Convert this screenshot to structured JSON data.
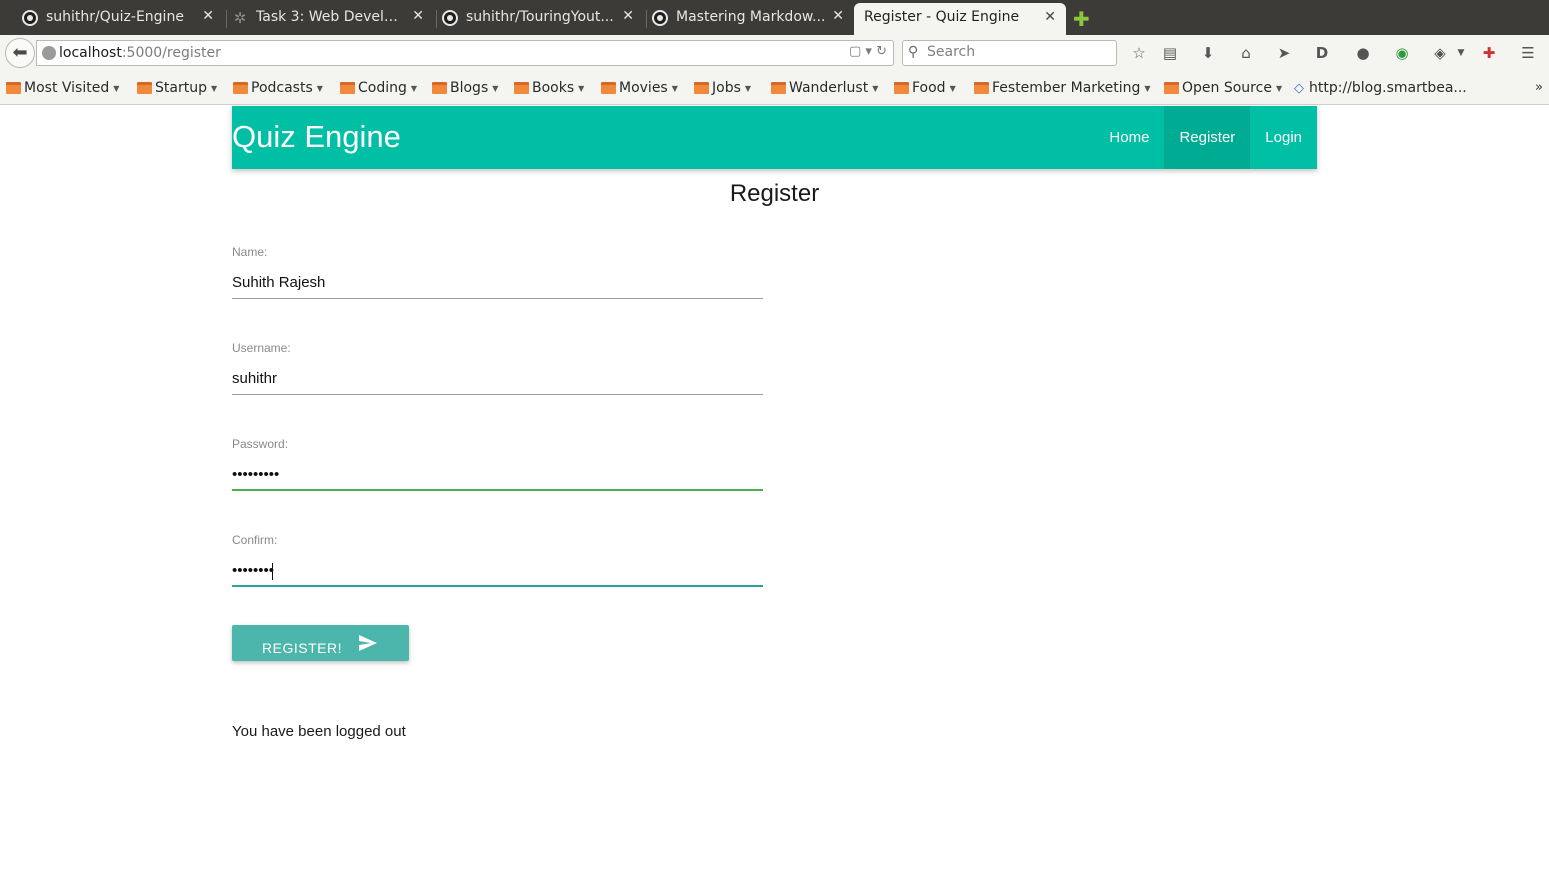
{
  "browser": {
    "tabs": [
      {
        "label": "suhithr/Quiz-Engine",
        "icon": "github-icon",
        "active": false
      },
      {
        "label": "Task 3: Web Develo...",
        "icon": "gear-icon",
        "active": false
      },
      {
        "label": "suhithr/TouringYout...",
        "icon": "github-icon",
        "active": false
      },
      {
        "label": "Mastering Markdow...",
        "icon": "github-icon",
        "active": false
      },
      {
        "label": "Register - Quiz Engine",
        "icon": "",
        "active": true
      }
    ],
    "url": {
      "host": "localhost",
      "rest": ":5000/register"
    },
    "search_placeholder": "Search",
    "bookmarks": [
      {
        "label": "Most Visited"
      },
      {
        "label": "Startup"
      },
      {
        "label": "Podcasts"
      },
      {
        "label": "Coding"
      },
      {
        "label": "Blogs"
      },
      {
        "label": "Books"
      },
      {
        "label": "Movies"
      },
      {
        "label": "Jobs"
      },
      {
        "label": "Wanderlust"
      },
      {
        "label": "Food"
      },
      {
        "label": "Festember Marketing"
      },
      {
        "label": "Open Source"
      },
      {
        "label": "http://blog.smartbea..."
      }
    ],
    "bookmarks_more": "»"
  },
  "app": {
    "brand": "Quiz Engine",
    "nav": [
      {
        "label": "Home"
      },
      {
        "label": "Register"
      },
      {
        "label": "Login"
      }
    ],
    "page_title": "Register",
    "form": {
      "name_label": "Name:",
      "name_value": "Suhith Rajesh",
      "username_label": "Username:",
      "username_value": "suhithr",
      "password_label": "Password:",
      "password_value": "•••••••••",
      "confirm_label": "Confirm:",
      "confirm_value": "••••••••",
      "submit_label": "REGISTER!"
    },
    "flash_message": "You have been logged out"
  },
  "colors": {
    "accent": "#00bfa5",
    "button": "#4db6ac",
    "valid_underline": "#4caf50",
    "focus_underline": "#26a69a"
  }
}
